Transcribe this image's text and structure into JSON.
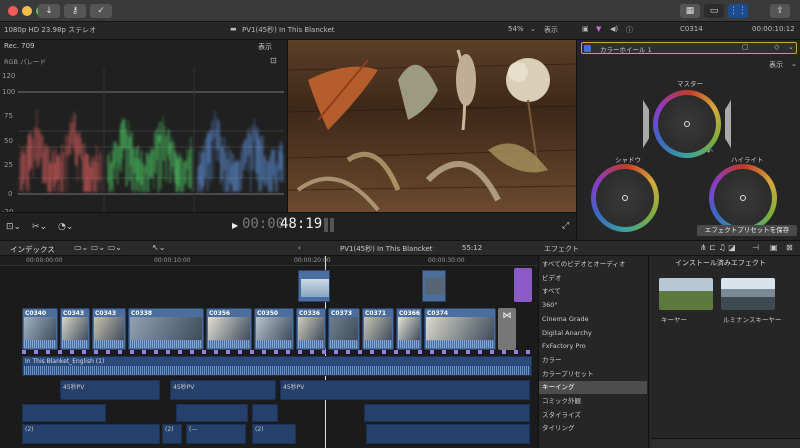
{
  "toolbar": {
    "buttons": [
      "download-icon",
      "key-icon",
      "check-icon"
    ],
    "right_buttons": [
      "grid-view-icon",
      "layout-icon",
      "sliders-icon",
      "share-icon"
    ]
  },
  "infobar": {
    "format": "1080p HD 23.98p ステレオ",
    "project_title": "PV1(45秒) In This Blancket",
    "zoom": "54%",
    "view_label": "表示",
    "clip_name": "C0314",
    "timecode": "00:00:10:12"
  },
  "scopes": {
    "header_left": "Rec. 709",
    "header_right": "表示",
    "mode": "RGB パレード",
    "y_ticks": [
      "120",
      "100",
      "75",
      "50",
      "25",
      "0",
      "-20"
    ],
    "channels": [
      "赤",
      "緑",
      "青"
    ]
  },
  "viewer_bottom": {
    "play_icon": "play-icon",
    "timecode_dim": "00:00",
    "timecode_bright": "48:19"
  },
  "inspector": {
    "effect_name": "カラーホイール 1",
    "view_label": "表示",
    "wheels": [
      "マスター",
      "シャドウ",
      "ハイライト"
    ],
    "save_preset": "エフェクトプリセットを保存"
  },
  "timeline_header": {
    "index_label": "インデックス",
    "project": "PV1(45秒) In This Blancket",
    "duration": "55:12",
    "effects_label": "エフェクト",
    "installed_label": "インストール済みエフェクト"
  },
  "ruler": [
    "00:00:00:00",
    "00:00:10:00",
    "00:00:20:00",
    "00:00:30:00"
  ],
  "clips": [
    "C0340",
    "C0343",
    "C0343",
    "C0338",
    "C0356",
    "C0350",
    "C0336",
    "C0373",
    "C0371",
    "C0366",
    "C0374"
  ],
  "audio_track": "In This Blanket_English (1)",
  "audio_labels": [
    "45秒PV",
    "45秒PV",
    "45秒PV",
    "(2)",
    "(2)",
    "(—",
    "(2)"
  ],
  "effects": {
    "categories": [
      "すべてのビデオとオーディオ",
      "ビデオ",
      "すべて",
      "360°",
      "Cinema Grade",
      "Digital Anarchy",
      "FxFactory Pro",
      "カラー",
      "カラープリセット",
      "キーイング",
      "コミック外観",
      "スタイライズ",
      "タイリング"
    ],
    "selected_index": 9,
    "thumbs": [
      "キーヤー",
      "ルミナンスキーヤー"
    ]
  }
}
